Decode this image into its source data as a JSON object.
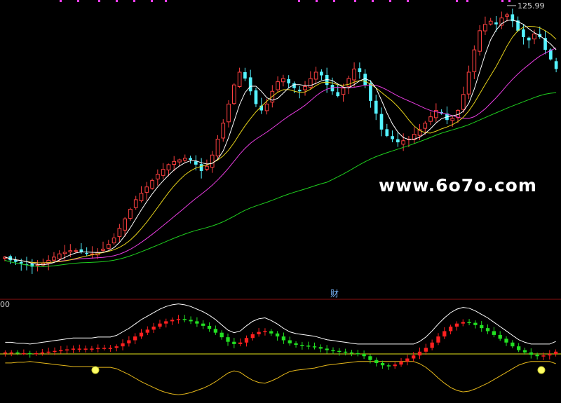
{
  "labels": {
    "high_price": "125.99",
    "indicator_tag": "财",
    "lower_value": "00",
    "watermark": "www.6o7o.com"
  },
  "colors": {
    "up": "#ff4040",
    "down": "#54f3ff",
    "ma_short": "#ffffff",
    "ma_mid": "#e6d21a",
    "ma_long": "#e83ce0",
    "ma_longest": "#1fd01f",
    "osc_up": "#ff2020",
    "osc_down": "#22e022",
    "band_upper": "#ffffff",
    "band_lower": "#e6b81a",
    "baseline": "#e6e61a",
    "marker": "#ffff66",
    "top_ticks": "#ff40ff"
  },
  "chart_data": [
    {
      "type": "candlestick",
      "title": "",
      "max_label": "125.99",
      "price_range": [
        44,
        126
      ],
      "closes": [
        48,
        47,
        46.5,
        46,
        45.5,
        45,
        45.5,
        46,
        47,
        48,
        49,
        49.5,
        50,
        50,
        49.5,
        49,
        49,
        49.5,
        50.5,
        52,
        54,
        57,
        60,
        63,
        66,
        68,
        70,
        72,
        74,
        75.5,
        77,
        78,
        78.5,
        79,
        78.5,
        77,
        75,
        76.5,
        80,
        85,
        90,
        96,
        102,
        106,
        104,
        100,
        96,
        94,
        96,
        100,
        103,
        104,
        102.5,
        101,
        100,
        101.5,
        104,
        106,
        105,
        102,
        100,
        98.5,
        101,
        104,
        107,
        106,
        102,
        97,
        93,
        88,
        86,
        85,
        84,
        84.5,
        85,
        86.5,
        88,
        90,
        92,
        94,
        93,
        91,
        91.5,
        94,
        99,
        106,
        113,
        119,
        121,
        122,
        121,
        123,
        124,
        122,
        119,
        117,
        116,
        118,
        117,
        113,
        110,
        107
      ]
    },
    {
      "type": "oscillator",
      "title": "",
      "label": "财",
      "range": [
        -6,
        6
      ],
      "baseline": 0,
      "values": [
        0.2,
        0.2,
        0.1,
        0.1,
        0,
        0.1,
        0.2,
        0.3,
        0.4,
        0.5,
        0.6,
        0.7,
        0.7,
        0.7,
        0.7,
        0.8,
        0.8,
        0.8,
        1,
        1.4,
        1.8,
        2.3,
        2.8,
        3.2,
        3.6,
        4,
        4.3,
        4.5,
        4.6,
        4.5,
        4.3,
        4,
        3.7,
        3.3,
        2.8,
        2.2,
        1.6,
        1.3,
        1.5,
        2.1,
        2.6,
        2.9,
        3,
        2.7,
        2.3,
        1.8,
        1.4,
        1.2,
        1.1,
        1,
        0.9,
        0.7,
        0.5,
        0.4,
        0.3,
        0.2,
        0.1,
        0,
        -0.3,
        -0.8,
        -1.2,
        -1.5,
        -1.6,
        -1.4,
        -1,
        -0.6,
        -0.2,
        0.3,
        0.8,
        1.5,
        2.3,
        3,
        3.6,
        4,
        4.2,
        4.1,
        3.8,
        3.4,
        3,
        2.5,
        2,
        1.5,
        1,
        0.5,
        0.2,
        -0.1,
        -0.3,
        -0.2,
        0,
        0.3
      ]
    }
  ]
}
